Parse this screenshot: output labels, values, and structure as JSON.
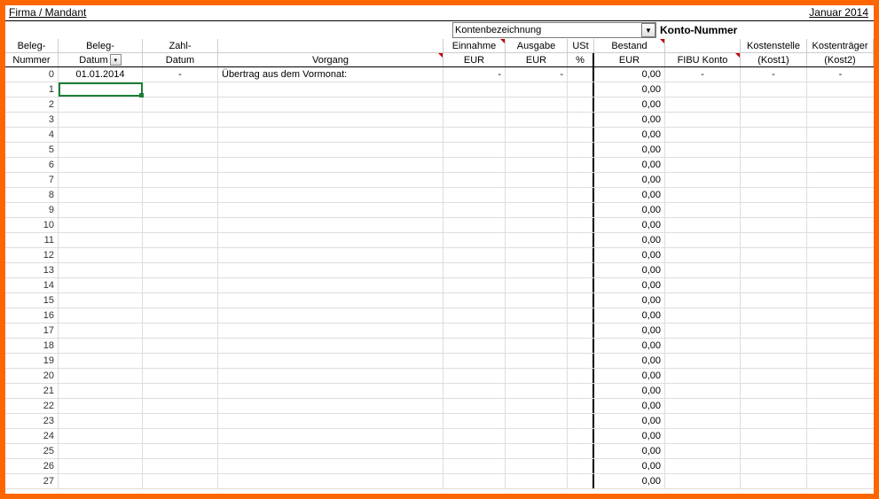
{
  "title": {
    "left": "Firma / Mandant",
    "right": "Januar 2014"
  },
  "dropdown": {
    "label": "Kontenbezeichnung"
  },
  "konto_label": "Konto-Nummer",
  "headers": {
    "row1": {
      "beleg": "Beleg-",
      "beleg2": "Beleg-",
      "zahl": "Zahl-",
      "vorgang": "",
      "ein": "Einnahme",
      "aus": "Ausgabe",
      "ust": "USt",
      "best": "Bestand",
      "fibu": "",
      "kost1": "Kostenstelle",
      "kost2": "Kostenträger"
    },
    "row2": {
      "beleg": "Nummer",
      "beleg2": "Datum",
      "zahl": "Datum",
      "vorgang": "Vorgang",
      "ein": "EUR",
      "aus": "EUR",
      "ust": "%",
      "best": "EUR",
      "fibu": "FIBU Konto",
      "kost1": "(Kost1)",
      "kost2": "(Kost2)"
    }
  },
  "rows": [
    {
      "n": "0",
      "date": "01.01.2014",
      "zahl": "-",
      "vorg": "Übertrag aus dem Vormonat:",
      "ein": "-",
      "aus": "-",
      "ust": "",
      "best": "0,00",
      "fibu": "-",
      "k1": "-",
      "k2": "-"
    },
    {
      "n": "1",
      "date": "",
      "zahl": "",
      "vorg": "",
      "ein": "",
      "aus": "",
      "ust": "",
      "best": "0,00",
      "fibu": "",
      "k1": "",
      "k2": "",
      "sel": true
    },
    {
      "n": "2",
      "date": "",
      "zahl": "",
      "vorg": "",
      "ein": "",
      "aus": "",
      "ust": "",
      "best": "0,00",
      "fibu": "",
      "k1": "",
      "k2": ""
    },
    {
      "n": "3",
      "date": "",
      "zahl": "",
      "vorg": "",
      "ein": "",
      "aus": "",
      "ust": "",
      "best": "0,00",
      "fibu": "",
      "k1": "",
      "k2": ""
    },
    {
      "n": "4",
      "date": "",
      "zahl": "",
      "vorg": "",
      "ein": "",
      "aus": "",
      "ust": "",
      "best": "0,00",
      "fibu": "",
      "k1": "",
      "k2": ""
    },
    {
      "n": "5",
      "date": "",
      "zahl": "",
      "vorg": "",
      "ein": "",
      "aus": "",
      "ust": "",
      "best": "0,00",
      "fibu": "",
      "k1": "",
      "k2": ""
    },
    {
      "n": "6",
      "date": "",
      "zahl": "",
      "vorg": "",
      "ein": "",
      "aus": "",
      "ust": "",
      "best": "0,00",
      "fibu": "",
      "k1": "",
      "k2": ""
    },
    {
      "n": "7",
      "date": "",
      "zahl": "",
      "vorg": "",
      "ein": "",
      "aus": "",
      "ust": "",
      "best": "0,00",
      "fibu": "",
      "k1": "",
      "k2": ""
    },
    {
      "n": "8",
      "date": "",
      "zahl": "",
      "vorg": "",
      "ein": "",
      "aus": "",
      "ust": "",
      "best": "0,00",
      "fibu": "",
      "k1": "",
      "k2": ""
    },
    {
      "n": "9",
      "date": "",
      "zahl": "",
      "vorg": "",
      "ein": "",
      "aus": "",
      "ust": "",
      "best": "0,00",
      "fibu": "",
      "k1": "",
      "k2": ""
    },
    {
      "n": "10",
      "date": "",
      "zahl": "",
      "vorg": "",
      "ein": "",
      "aus": "",
      "ust": "",
      "best": "0,00",
      "fibu": "",
      "k1": "",
      "k2": ""
    },
    {
      "n": "11",
      "date": "",
      "zahl": "",
      "vorg": "",
      "ein": "",
      "aus": "",
      "ust": "",
      "best": "0,00",
      "fibu": "",
      "k1": "",
      "k2": ""
    },
    {
      "n": "12",
      "date": "",
      "zahl": "",
      "vorg": "",
      "ein": "",
      "aus": "",
      "ust": "",
      "best": "0,00",
      "fibu": "",
      "k1": "",
      "k2": ""
    },
    {
      "n": "13",
      "date": "",
      "zahl": "",
      "vorg": "",
      "ein": "",
      "aus": "",
      "ust": "",
      "best": "0,00",
      "fibu": "",
      "k1": "",
      "k2": ""
    },
    {
      "n": "14",
      "date": "",
      "zahl": "",
      "vorg": "",
      "ein": "",
      "aus": "",
      "ust": "",
      "best": "0,00",
      "fibu": "",
      "k1": "",
      "k2": ""
    },
    {
      "n": "15",
      "date": "",
      "zahl": "",
      "vorg": "",
      "ein": "",
      "aus": "",
      "ust": "",
      "best": "0,00",
      "fibu": "",
      "k1": "",
      "k2": ""
    },
    {
      "n": "16",
      "date": "",
      "zahl": "",
      "vorg": "",
      "ein": "",
      "aus": "",
      "ust": "",
      "best": "0,00",
      "fibu": "",
      "k1": "",
      "k2": ""
    },
    {
      "n": "17",
      "date": "",
      "zahl": "",
      "vorg": "",
      "ein": "",
      "aus": "",
      "ust": "",
      "best": "0,00",
      "fibu": "",
      "k1": "",
      "k2": ""
    },
    {
      "n": "18",
      "date": "",
      "zahl": "",
      "vorg": "",
      "ein": "",
      "aus": "",
      "ust": "",
      "best": "0,00",
      "fibu": "",
      "k1": "",
      "k2": ""
    },
    {
      "n": "19",
      "date": "",
      "zahl": "",
      "vorg": "",
      "ein": "",
      "aus": "",
      "ust": "",
      "best": "0,00",
      "fibu": "",
      "k1": "",
      "k2": ""
    },
    {
      "n": "20",
      "date": "",
      "zahl": "",
      "vorg": "",
      "ein": "",
      "aus": "",
      "ust": "",
      "best": "0,00",
      "fibu": "",
      "k1": "",
      "k2": ""
    },
    {
      "n": "21",
      "date": "",
      "zahl": "",
      "vorg": "",
      "ein": "",
      "aus": "",
      "ust": "",
      "best": "0,00",
      "fibu": "",
      "k1": "",
      "k2": ""
    },
    {
      "n": "22",
      "date": "",
      "zahl": "",
      "vorg": "",
      "ein": "",
      "aus": "",
      "ust": "",
      "best": "0,00",
      "fibu": "",
      "k1": "",
      "k2": ""
    },
    {
      "n": "23",
      "date": "",
      "zahl": "",
      "vorg": "",
      "ein": "",
      "aus": "",
      "ust": "",
      "best": "0,00",
      "fibu": "",
      "k1": "",
      "k2": ""
    },
    {
      "n": "24",
      "date": "",
      "zahl": "",
      "vorg": "",
      "ein": "",
      "aus": "",
      "ust": "",
      "best": "0,00",
      "fibu": "",
      "k1": "",
      "k2": ""
    },
    {
      "n": "25",
      "date": "",
      "zahl": "",
      "vorg": "",
      "ein": "",
      "aus": "",
      "ust": "",
      "best": "0,00",
      "fibu": "",
      "k1": "",
      "k2": ""
    },
    {
      "n": "26",
      "date": "",
      "zahl": "",
      "vorg": "",
      "ein": "",
      "aus": "",
      "ust": "",
      "best": "0,00",
      "fibu": "",
      "k1": "",
      "k2": ""
    },
    {
      "n": "27",
      "date": "",
      "zahl": "",
      "vorg": "",
      "ein": "",
      "aus": "",
      "ust": "",
      "best": "0,00",
      "fibu": "",
      "k1": "",
      "k2": ""
    }
  ]
}
